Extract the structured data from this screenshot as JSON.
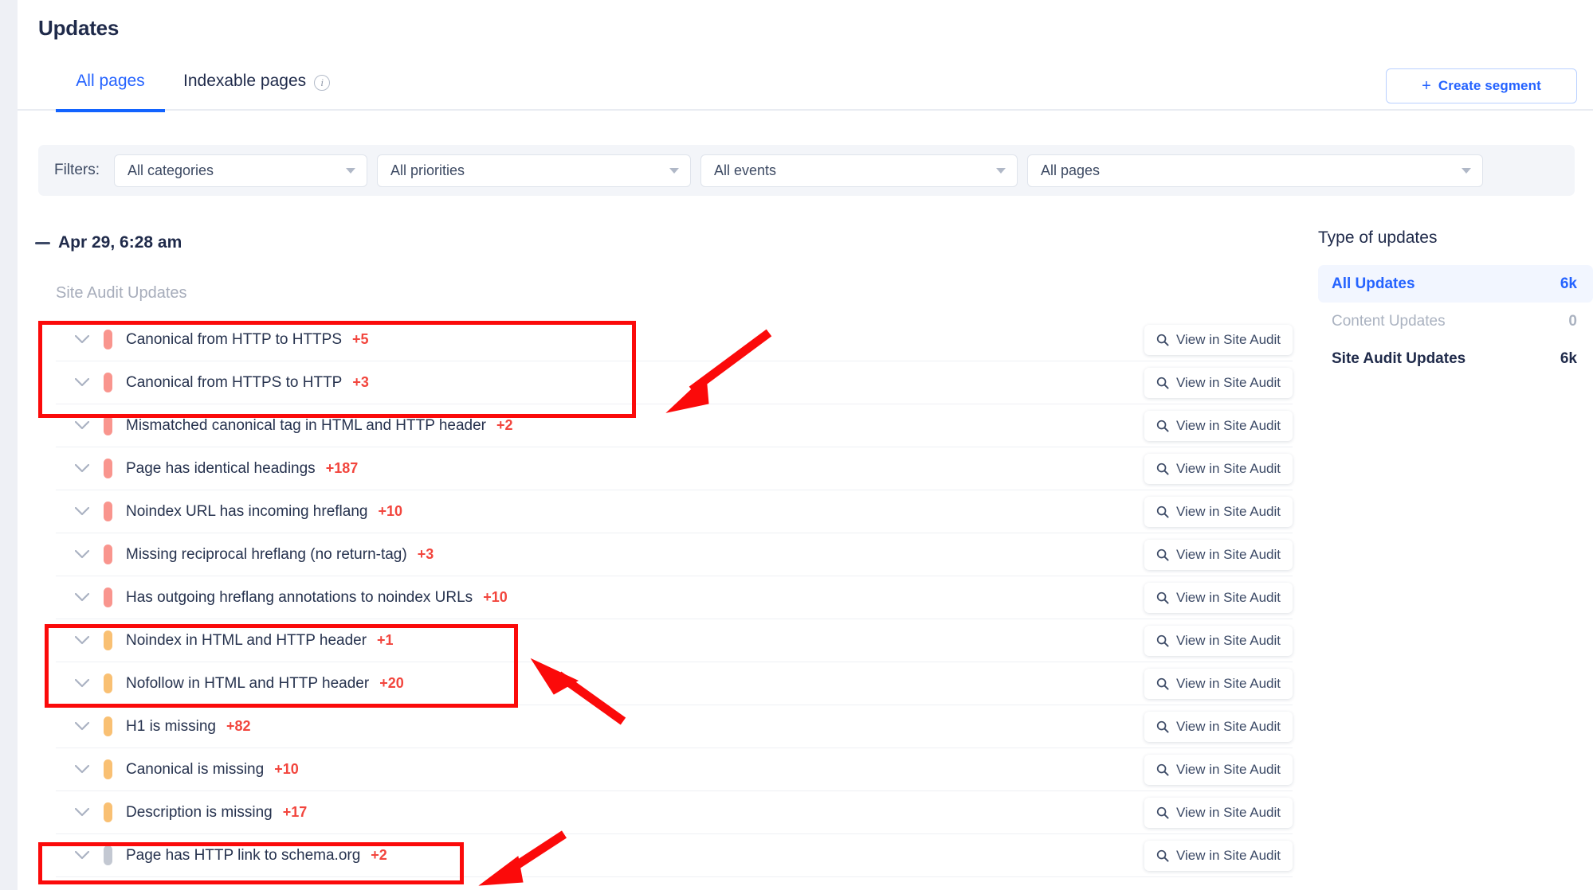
{
  "header": {
    "title": "Updates",
    "tabs": [
      {
        "label": "All pages",
        "active": true
      },
      {
        "label": "Indexable pages",
        "active": false,
        "info_icon": "info-icon"
      }
    ],
    "create_segment": {
      "label": "Create segment",
      "plus": "+"
    }
  },
  "filters": {
    "label": "Filters:",
    "selects": [
      {
        "name": "categories",
        "value": "All categories"
      },
      {
        "name": "priorities",
        "value": "All priorities"
      },
      {
        "name": "events",
        "value": "All events"
      },
      {
        "name": "pages",
        "value": "All pages"
      }
    ]
  },
  "group": {
    "date": "Apr 29, 6:28 am",
    "subtitle": "Site Audit Updates"
  },
  "view_button_label": "View in Site Audit",
  "updates": [
    {
      "label": "Canonical from HTTP to HTTPS",
      "delta": "+5",
      "priority": "high"
    },
    {
      "label": "Canonical from HTTPS to HTTP",
      "delta": "+3",
      "priority": "high"
    },
    {
      "label": "Mismatched canonical tag in HTML and HTTP header",
      "delta": "+2",
      "priority": "high"
    },
    {
      "label": "Page has identical headings",
      "delta": "+187",
      "priority": "high"
    },
    {
      "label": "Noindex URL has incoming hreflang",
      "delta": "+10",
      "priority": "high"
    },
    {
      "label": "Missing reciprocal hreflang (no return-tag)",
      "delta": "+3",
      "priority": "high"
    },
    {
      "label": "Has outgoing hreflang annotations to noindex URLs",
      "delta": "+10",
      "priority": "high"
    },
    {
      "label": "Noindex in HTML and HTTP header",
      "delta": "+1",
      "priority": "medium"
    },
    {
      "label": "Nofollow in HTML and HTTP header",
      "delta": "+20",
      "priority": "medium"
    },
    {
      "label": "H1 is missing",
      "delta": "+82",
      "priority": "medium"
    },
    {
      "label": "Canonical is missing",
      "delta": "+10",
      "priority": "medium"
    },
    {
      "label": "Description is missing",
      "delta": "+17",
      "priority": "medium"
    },
    {
      "label": "Page has HTTP link to schema.org",
      "delta": "+2",
      "priority": "low"
    }
  ],
  "type_of_updates": {
    "title": "Type of updates",
    "items": [
      {
        "label": "All Updates",
        "count": "6k",
        "state": "selected"
      },
      {
        "label": "Content Updates",
        "count": "0",
        "state": "muted"
      },
      {
        "label": "Site Audit Updates",
        "count": "6k",
        "state": "normal"
      }
    ]
  },
  "colors": {
    "accent": "#2563ff",
    "delta": "#f2453d",
    "priority_high": "#f9958e",
    "priority_medium": "#f9c073",
    "priority_low": "#c3c8d2",
    "annotation": "#fb0a0a"
  }
}
